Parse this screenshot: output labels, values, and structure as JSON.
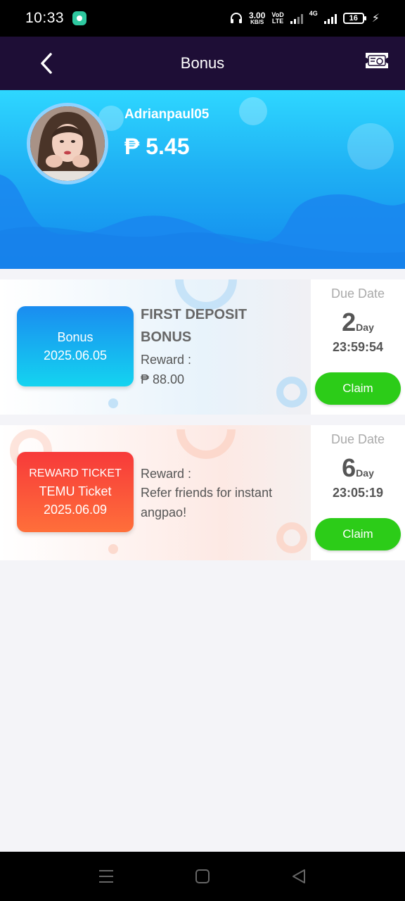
{
  "status_bar": {
    "time": "10:33",
    "net_speed_value": "3.00",
    "net_speed_unit": "KB/S",
    "volte_line1": "VoD",
    "volte_line2": "LTE",
    "network_type": "4G",
    "battery_level": "16"
  },
  "header": {
    "title": "Bonus"
  },
  "profile": {
    "username": "Adrianpaul05",
    "balance": "₱ 5.45"
  },
  "bonuses": [
    {
      "badge_lines": [
        "Bonus",
        "2025.06.05"
      ],
      "title": "FIRST DEPOSIT BONUS",
      "reward_label": "Reward :",
      "reward_value": "₱ 88.00",
      "due_label": "Due Date",
      "due_days": "2",
      "due_unit": "Day",
      "due_time": "23:59:54",
      "claim_label": "Claim"
    },
    {
      "badge_lines": [
        "REWARD TICKET",
        "TEMU Ticket",
        "2025.06.09"
      ],
      "reward_label": "Reward :",
      "reward_value": "Refer friends for instant angpao!",
      "due_label": "Due Date",
      "due_days": "6",
      "due_unit": "Day",
      "due_time": "23:05:19",
      "claim_label": "Claim"
    }
  ],
  "colors": {
    "header_bg": "#1e0e36",
    "hero_top": "#2ed7ff",
    "hero_bottom": "#1289ee",
    "claim_green": "#2ccc18",
    "bonus_badge": "#1a8cf0",
    "reward_badge": "#f73a3a"
  },
  "icons": {
    "back": "chevron-left-icon",
    "ticket": "ticket-icon",
    "nav_menu": "menu-icon",
    "nav_home": "square-icon",
    "nav_back": "triangle-back-icon"
  }
}
